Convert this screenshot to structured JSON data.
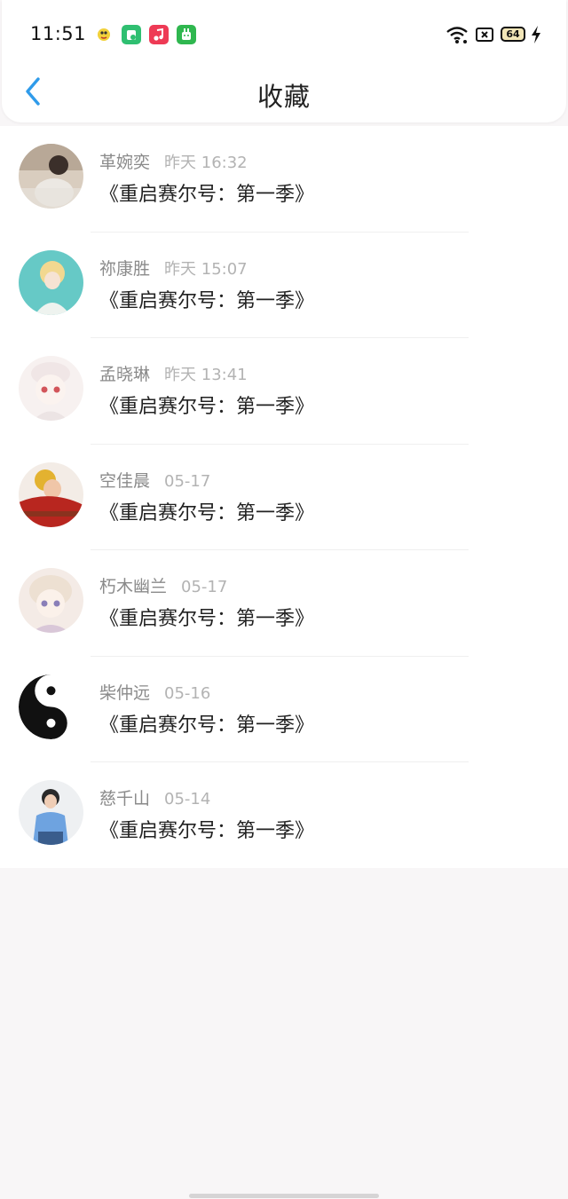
{
  "status_bar": {
    "time": "11:51",
    "battery_level": "64",
    "icons": [
      "bird-app-icon",
      "green-app-icon",
      "music-app-icon",
      "android-app-icon",
      "wifi-icon",
      "sim-icon",
      "battery-icon",
      "charging-bolt-icon"
    ]
  },
  "header": {
    "title": "收藏",
    "back_icon": "chevron-left-icon",
    "accent_color": "#2f9bea"
  },
  "items": [
    {
      "user": "革婉奕",
      "time": "昨天 16:32",
      "title": "《重启赛尔号：第一季》"
    },
    {
      "user": "祢康胜",
      "time": "昨天 15:07",
      "title": "《重启赛尔号：第一季》"
    },
    {
      "user": "孟晓琳",
      "time": "昨天 13:41",
      "title": "《重启赛尔号：第一季》"
    },
    {
      "user": "空佳晨",
      "time": "05-17",
      "title": "《重启赛尔号：第一季》"
    },
    {
      "user": "朽木幽兰",
      "time": "05-17",
      "title": "《重启赛尔号：第一季》"
    },
    {
      "user": "柴仲远",
      "time": "05-16",
      "title": "《重启赛尔号：第一季》"
    },
    {
      "user": "慈千山",
      "time": "05-14",
      "title": "《重启赛尔号：第一季》"
    }
  ]
}
